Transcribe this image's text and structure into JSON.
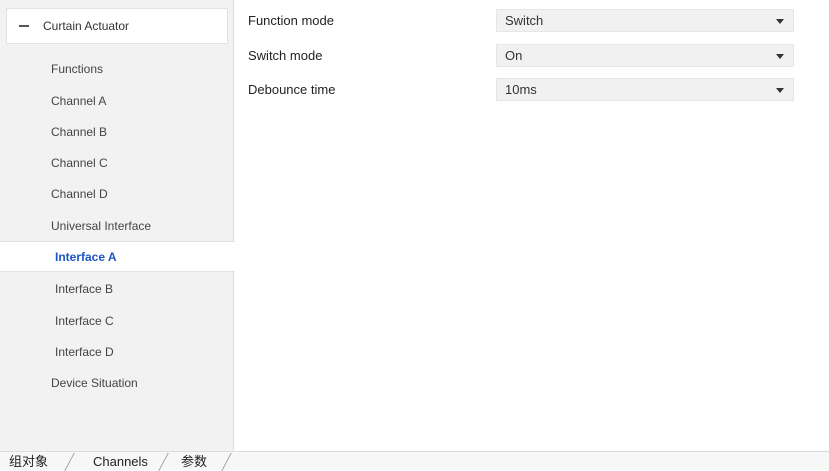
{
  "sidebar": {
    "header": {
      "title": "Curtain Actuator",
      "collapse_symbol": "minus-icon"
    },
    "items": [
      {
        "label": "Functions"
      },
      {
        "label": "Channel A"
      },
      {
        "label": "Channel B"
      },
      {
        "label": "Channel C"
      },
      {
        "label": "Channel D"
      },
      {
        "label": "Universal Interface"
      },
      {
        "label": "Interface A"
      },
      {
        "label": "Interface B"
      },
      {
        "label": "Interface C"
      },
      {
        "label": "Interface D"
      },
      {
        "label": "Device Situation"
      }
    ],
    "selected_item": "Interface A"
  },
  "params": [
    {
      "label": "Function mode",
      "value": "Switch"
    },
    {
      "label": "Switch mode",
      "value": "On"
    },
    {
      "label": "Debounce time",
      "value": "10ms"
    }
  ],
  "tabs": [
    {
      "label": "组对象"
    },
    {
      "label": "Channels"
    },
    {
      "label": "参数"
    }
  ],
  "active_tab": "参数",
  "colors": {
    "selected_text": "#1a56c4",
    "sidebar_bg": "#f2f2f2",
    "select_bg": "#f1f1f1"
  }
}
